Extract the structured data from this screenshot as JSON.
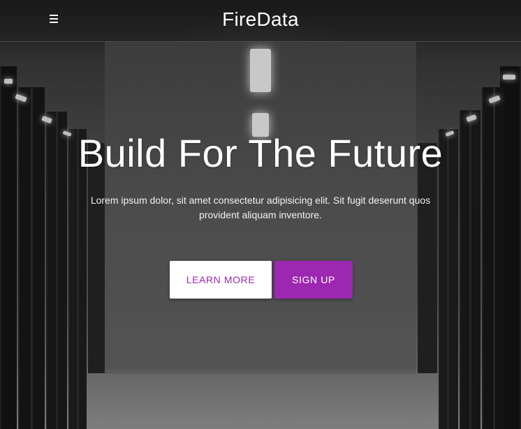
{
  "navbar": {
    "brand": "FireData",
    "menu_icon": "hamburger-menu-icon"
  },
  "hero": {
    "title": "Build For The Future",
    "text": "Lorem ipsum dolor, sit amet consectetur adipisicing elit. Sit fugit deserunt quos provident aliquam inventore.",
    "buttons": {
      "learn_more": "Learn More",
      "sign_up": "Sign Up"
    }
  },
  "colors": {
    "accent": "#9c27b0",
    "button_light": "#ffffff",
    "text": "#ffffff"
  }
}
